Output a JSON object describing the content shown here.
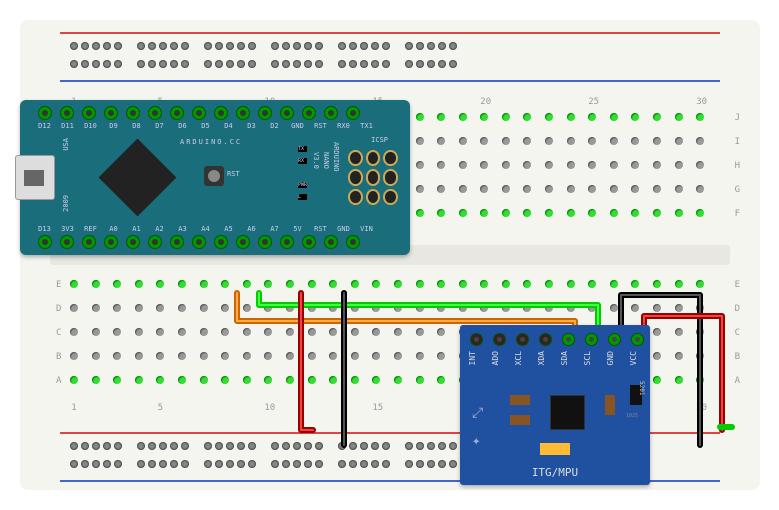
{
  "breadboard": {
    "columns": [
      1,
      5,
      10,
      15,
      20,
      25,
      30
    ],
    "rows": [
      "A",
      "B",
      "C",
      "D",
      "E",
      "F",
      "G",
      "H",
      "I",
      "J"
    ]
  },
  "nano": {
    "board_text": "ARDUINO.CC",
    "model": "ARDUINO",
    "model2": "NANO",
    "version": "V3.0",
    "year": "2009",
    "region": "USA",
    "icsp": "ICSP",
    "top_pins": [
      "D12",
      "D11",
      "D10",
      "D9",
      "D8",
      "D7",
      "D6",
      "D5",
      "D4",
      "D3",
      "D2",
      "GND",
      "RST",
      "RX0",
      "TX1"
    ],
    "bot_pins": [
      "D13",
      "3V3",
      "REF",
      "A0",
      "A1",
      "A2",
      "A3",
      "A4",
      "A5",
      "A6",
      "A7",
      "5V",
      "RST",
      "GND",
      "VIN"
    ],
    "leds": [
      "TX",
      "RX",
      "PWR",
      "L"
    ],
    "rst": "RST"
  },
  "mpu": {
    "name": "ITG/MPU",
    "pins": [
      "INT",
      "ADO",
      "XCL",
      "XDA",
      "SDA",
      "SCL",
      "GND",
      "VCC"
    ],
    "chip_label": "5201",
    "chip_label2": "1025"
  }
}
